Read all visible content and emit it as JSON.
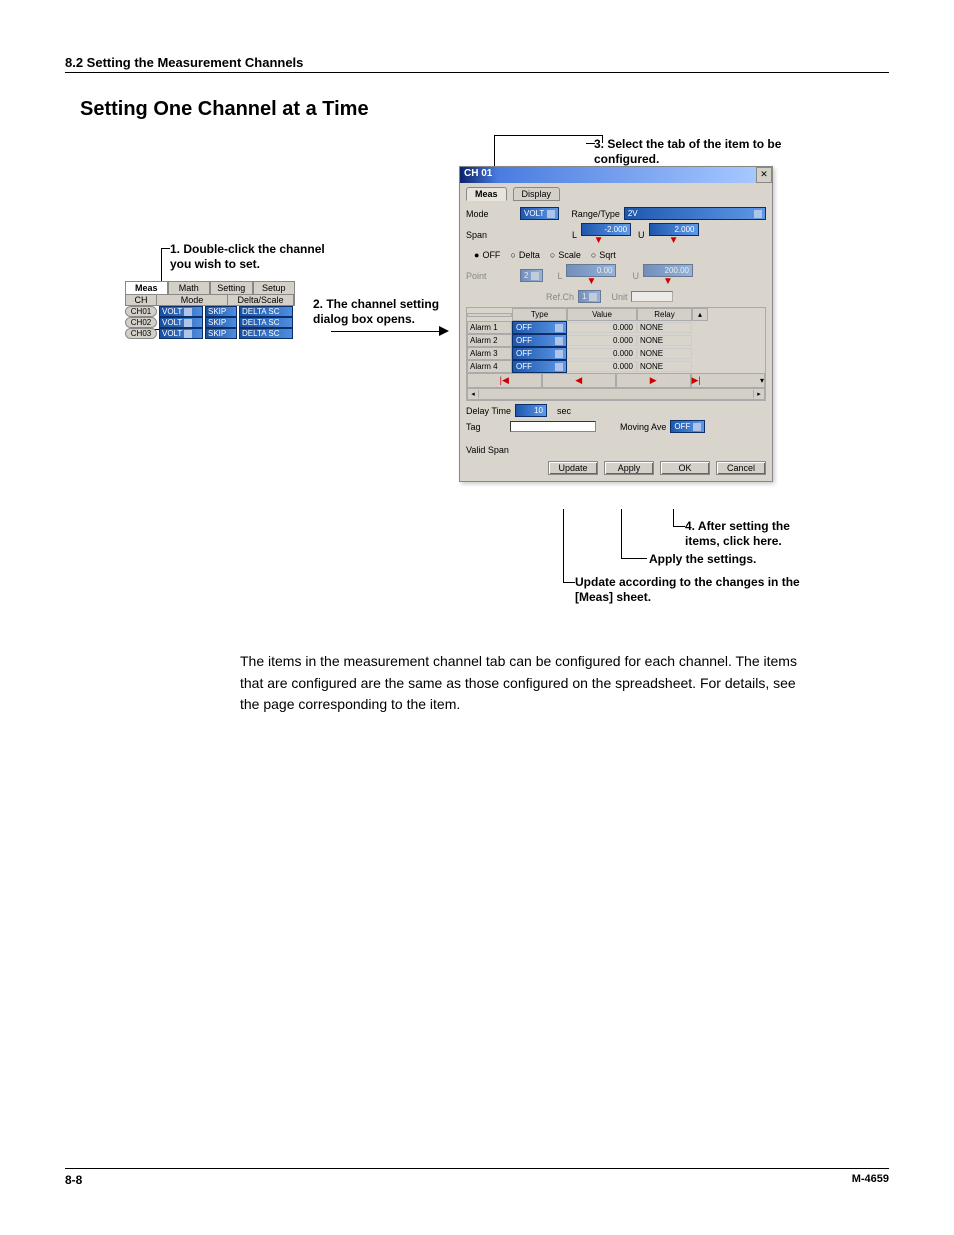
{
  "header": {
    "section": "8.2  Setting the Measurement Channels"
  },
  "title": "Setting One Channel at a Time",
  "callouts": {
    "c1": "1. Double-click the channel you wish to set.",
    "c2": "2. The channel setting dialog box opens.",
    "c3": "3. Select the tab of the item to be configured.",
    "c4": "4. After setting the items, click here.",
    "c5": "Apply the settings.",
    "c6": "Update according to the changes in the [Meas] sheet."
  },
  "small_window": {
    "tabs": [
      "Meas",
      "Math",
      "Setting",
      "Setup"
    ],
    "head_left": "CH",
    "head_mode": "Mode",
    "head_ds": "Delta/Scale",
    "rows": [
      {
        "ch": "CH01",
        "mode": "VOLT",
        "v": "SKIP",
        "ds": "DELTA  SC"
      },
      {
        "ch": "CH02",
        "mode": "VOLT",
        "v": "SKIP",
        "ds": "DELTA  SC"
      },
      {
        "ch": "CH03",
        "mode": "VOLT",
        "v": "SKIP",
        "ds": "DELTA  SC"
      }
    ]
  },
  "dialog": {
    "title": "CH 01",
    "tabs": [
      "Meas",
      "Display"
    ],
    "mode_lbl": "Mode",
    "mode_val": "VOLT",
    "range_lbl": "Range/Type",
    "range_val": "2V",
    "span_lbl": "Span",
    "span_L": "L",
    "span_L_val": "-2.000",
    "span_U": "U",
    "span_U_val": "2.000",
    "radios": [
      "OFF",
      "Delta",
      "Scale",
      "Sqrt"
    ],
    "point_lbl": "Point",
    "point_val": "2",
    "point_L": "L",
    "point_L_val": "0.00",
    "point_U": "U",
    "point_U_val": "200.00",
    "refch_lbl": "Ref.Ch",
    "refch_val": "1",
    "unit_lbl": "Unit",
    "unit_val": "",
    "alarm_head": [
      "",
      "Type",
      "Value",
      "Relay",
      ""
    ],
    "alarms": [
      {
        "name": "Alarm 1",
        "type": "OFF",
        "value": "0.000",
        "relay": "NONE"
      },
      {
        "name": "Alarm 2",
        "type": "OFF",
        "value": "0.000",
        "relay": "NONE"
      },
      {
        "name": "Alarm 3",
        "type": "OFF",
        "value": "0.000",
        "relay": "NONE"
      },
      {
        "name": "Alarm 4",
        "type": "OFF",
        "value": "0.000",
        "relay": "NONE"
      }
    ],
    "last_row": {
      "a": "",
      "b": "",
      "c": "",
      "d": ""
    },
    "delay_lbl": "Delay Time",
    "delay_val": "10",
    "delay_unit": "sec",
    "tag_lbl": "Tag",
    "tag_val": "",
    "movave_lbl": "Moving Ave",
    "movave_val": "OFF",
    "valid_lbl": "Valid Span",
    "buttons": {
      "update": "Update",
      "apply": "Apply",
      "ok": "OK",
      "cancel": "Cancel"
    }
  },
  "body_text": "The items in the measurement channel tab can be configured for each channel.  The items that are configured are the same as those configured on the spreadsheet.  For details, see the page corresponding to the item.",
  "footer": {
    "left": "8-8",
    "right": "M-4659"
  }
}
